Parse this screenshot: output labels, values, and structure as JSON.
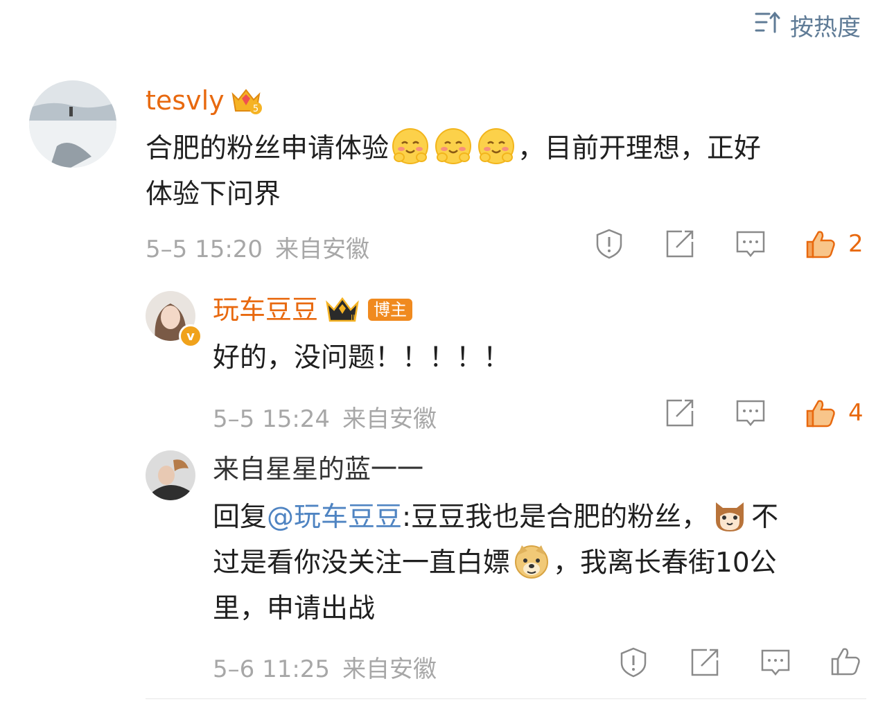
{
  "sort": {
    "label": "按热度"
  },
  "comments": [
    {
      "username": "tesvly",
      "text_1": "合肥的粉丝申请体验",
      "text_2": "，目前开理想，正好",
      "text_3": "体验下问界",
      "date": "5–5 15:20",
      "location": "来自安徽",
      "likes": "2"
    },
    {
      "username": "玩车豆豆",
      "badge": "博主",
      "text": "好的，没问题！！！！！",
      "date": "5–5 15:24",
      "location": "来自安徽",
      "likes": "4"
    },
    {
      "username": "来自星星的蓝一一",
      "reply_prefix": "回复",
      "mention": "@玩车豆豆",
      "text_1": ":豆豆我也是合肥的粉丝，",
      "text_2": "不",
      "text_3": "过是看你没关注一直白嫖",
      "text_4": "，我离长春街10公",
      "text_5": "里，申请出战",
      "date": "5–6 11:25",
      "location": "来自安徽"
    }
  ],
  "icons": [
    "sort-icon",
    "report-icon",
    "repost-icon",
    "comment-icon",
    "like-icon",
    "emoji-hug-icon",
    "emoji-cat-icon",
    "emoji-doge-icon",
    "crown-icon"
  ],
  "colors": {
    "accent": "#e8690f",
    "link": "#4f84c2",
    "meta": "#a7a7a7"
  }
}
